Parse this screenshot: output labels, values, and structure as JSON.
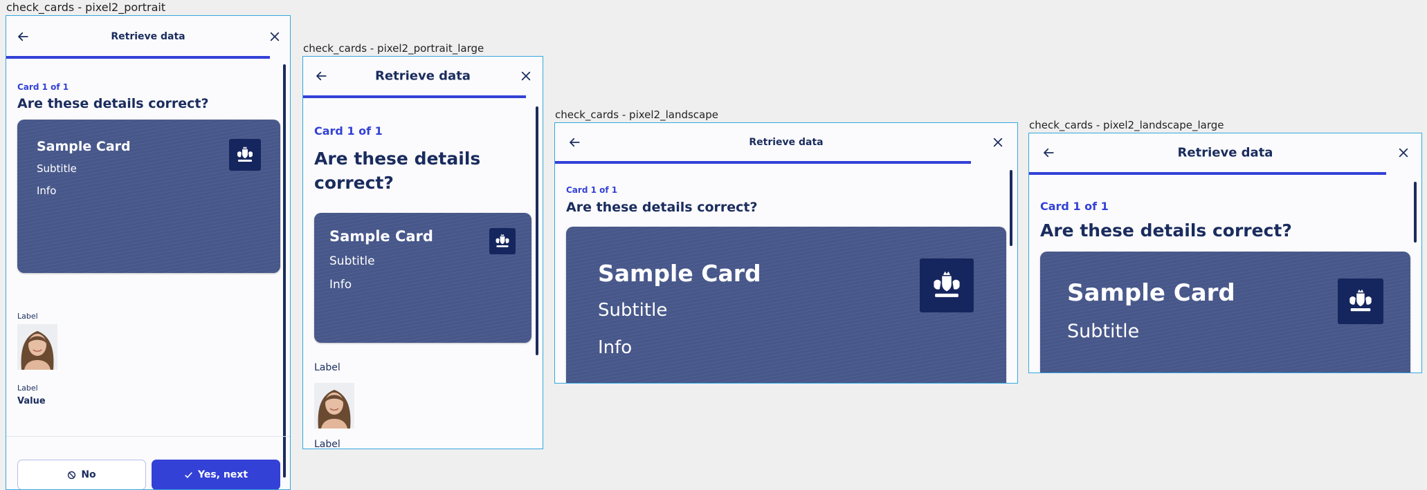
{
  "screens": [
    {
      "caption": "check_cards - pixel2_portrait"
    },
    {
      "caption": "check_cards - pixel2_portrait_large"
    },
    {
      "caption": "check_cards - pixel2_landscape"
    },
    {
      "caption": "check_cards - pixel2_landscape_large"
    }
  ],
  "screen": {
    "title": "Retrieve data",
    "step": "Card 1 of 1",
    "question": "Are these details correct?",
    "progress_fraction": 0.93,
    "card": {
      "title": "Sample Card",
      "subtitle": "Subtitle",
      "info": "Info"
    },
    "photo_label": "Label",
    "field_label": "Label",
    "field_value": "Value",
    "no_button": "No",
    "yes_button": "Yes, next"
  },
  "colors": {
    "primary": "#3341d6",
    "text": "#1a2c5e",
    "card": "#47578a",
    "logo_bg": "#15265e",
    "frame_border": "#35a7dd"
  },
  "icons": {
    "back": "arrow-left-icon",
    "close": "close-icon",
    "no": "block-icon",
    "yes": "check-icon",
    "logo": "coat-of-arms-icon",
    "photo": "portrait-photo"
  }
}
